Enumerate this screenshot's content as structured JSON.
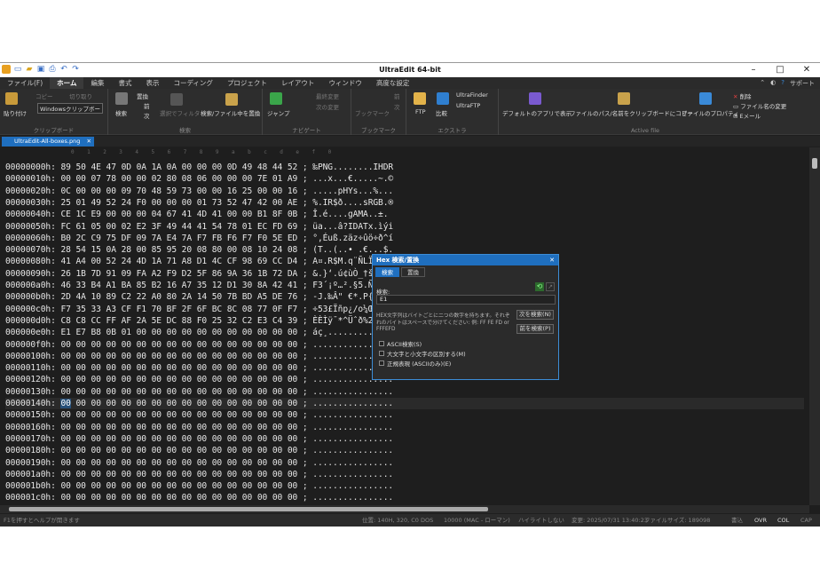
{
  "titlebar": {
    "title": "UltraEdit 64-bit"
  },
  "menu": [
    "ファイル(F)",
    "ホーム",
    "編集",
    "書式",
    "表示",
    "コーディング",
    "プロジェクト",
    "レイアウト",
    "ウィンドウ",
    "高度な設定"
  ],
  "menu_right": {
    "support": "サポート"
  },
  "ribbon": {
    "paste": "貼り付け",
    "copy": "コピー",
    "cut": "切り取り",
    "clipboard": "Windowsクリップボー",
    "clipboard_group": "クリップボード",
    "search": "検索",
    "replace": "置換",
    "prev": "前",
    "next": "次",
    "filter": "選択でフィルタ",
    "find_in_files": "検索/ファイル中を置換",
    "search_group": "検索",
    "jump": "ジャンプ",
    "last_change": "最終変更",
    "next_change": "次の変更",
    "navigate_group": "ナビゲート",
    "bookmark": "ブックマーク",
    "bm_prev": "前",
    "bm_next": "次",
    "bookmark_group": "ブックマーク",
    "ftp": "FTP",
    "compare": "比較",
    "ultrafinder": "UltraFinder",
    "ultraftp": "UltraFTP",
    "extra_group": "エクストラ",
    "default_app": "デフォルトのアプリで表示",
    "copy_path": "ファイルのパス/名前をクリップボードにコピー",
    "properties": "ファイルのプロパティ",
    "delete": "削除",
    "rename": "ファイル名の変更",
    "email": "Eメール",
    "active_file_group": "Active file"
  },
  "file_tab": "UltraEdit-All-boxes.png",
  "ruler": [
    "0",
    "1",
    "2",
    "3",
    "4",
    "5",
    "6",
    "7",
    "8",
    "9",
    "a",
    "b",
    "c",
    "d",
    "e",
    "f",
    "0"
  ],
  "rows": [
    {
      "addr": "00000000h:",
      "hex": "89 50 4E 47 0D 0A 1A 0A 00 00 00 0D 49 48 44 52",
      "txt": "‰PNG........IHDR"
    },
    {
      "addr": "00000010h:",
      "hex": "00 00 07 78 00 00 02 80 08 06 00 00 00 7E 01 A9",
      "txt": "...x...€.....~.©"
    },
    {
      "addr": "00000020h:",
      "hex": "0C 00 00 00 09 70 48 59 73 00 00 16 25 00 00 16",
      "txt": ".....pHYs...%..."
    },
    {
      "addr": "00000030h:",
      "hex": "25 01 49 52 24 F0 00 00 00 01 73 52 47 42 00 AE",
      "txt": "%.IR$ð....sRGB.®"
    },
    {
      "addr": "00000040h:",
      "hex": "CE 1C E9 00 00 00 04 67 41 4D 41 00 00 B1 8F 0B",
      "txt": "Î.é....gAMA..±."
    },
    {
      "addr": "00000050h:",
      "hex": "FC 61 05 00 02 E2 3F 49 44 41 54 78 01 EC FD 69",
      "txt": "üa...â?IDATx.ìýi"
    },
    {
      "addr": "00000060h:",
      "hex": "B0 2C C9 75 DF 09 7A E4 7A F7 FB F6 F7 F0 5E ED",
      "txt": "°,Éuß.zäz÷ûö÷ð^í"
    },
    {
      "addr": "00000070h:",
      "hex": "28 54 15 0A 28 00 85 95 20 08 80 00 08 10 24 08",
      "txt": "(T..(..• .€...$."
    },
    {
      "addr": "00000080h:",
      "hex": "41 A4 00 52 24 4D 1A 71 A8 D1 4C CF 98 69 CC D4",
      "txt": "A¤.R$M.q¨ÑLÏ˜iÌÔ"
    },
    {
      "addr": "00000090h:",
      "hex": "26 1B 7D 91 09 FA A2 F9 D2 5F 86 9A 36 1B 72 DA",
      "txt": "&.}‘.ú¢ùÒ_†š6.rÚ"
    },
    {
      "addr": "000000a0h:",
      "hex": "46 33 B4 A1 BA 85 B2 16 A7 35 12 D1 30 8A 42 41",
      "txt": "F3´¡º…².§5.Ñ0ŠBA"
    },
    {
      "addr": "000000b0h:",
      "hex": "2D 4A 10 89 C2 22 A0 80 2A 14 50 7B BD A5 DE 76",
      "txt": "-J.‰Â\" €*.P{½¥Þv"
    },
    {
      "addr": "000000c0h:",
      "hex": "F7 35 33 A3 CF F1 70 BF 2F 6F BC 8C 08 77 0F F7",
      "txt": "÷53£Ïñp¿/o¼Œ.w.÷"
    },
    {
      "addr": "000000d0h:",
      "hex": "C8 C8 CC FF AF 2A 5E DC 88 F0 25 32 C2 E3 C4 39",
      "txt": "ÈÈÌÿ¯*^Üˆð%2ÂãÄ9"
    },
    {
      "addr": "000000e0h:",
      "hex": "E1 E7 B8 0B 01 00 00 00 00 00 00 00 00 00 00 00",
      "txt": "áç¸............."
    },
    {
      "addr": "000000f0h:",
      "hex": "00 00 00 00 00 00 00 00 00 00 00 00 00 00 00 00",
      "txt": "................"
    },
    {
      "addr": "00000100h:",
      "hex": "00 00 00 00 00 00 00 00 00 00 00 00 00 00 00 00",
      "txt": "................"
    },
    {
      "addr": "00000110h:",
      "hex": "00 00 00 00 00 00 00 00 00 00 00 00 00 00 00 00",
      "txt": "................"
    },
    {
      "addr": "00000120h:",
      "hex": "00 00 00 00 00 00 00 00 00 00 00 00 00 00 00 00",
      "txt": "................"
    },
    {
      "addr": "00000130h:",
      "hex": "00 00 00 00 00 00 00 00 00 00 00 00 00 00 00 00",
      "txt": "................"
    },
    {
      "addr": "00000140h:",
      "hex": "00 00 00 00 00 00 00 00 00 00 00 00 00 00 00 00",
      "txt": "................",
      "cur": true
    },
    {
      "addr": "00000150h:",
      "hex": "00 00 00 00 00 00 00 00 00 00 00 00 00 00 00 00",
      "txt": "................"
    },
    {
      "addr": "00000160h:",
      "hex": "00 00 00 00 00 00 00 00 00 00 00 00 00 00 00 00",
      "txt": "................"
    },
    {
      "addr": "00000170h:",
      "hex": "00 00 00 00 00 00 00 00 00 00 00 00 00 00 00 00",
      "txt": "................"
    },
    {
      "addr": "00000180h:",
      "hex": "00 00 00 00 00 00 00 00 00 00 00 00 00 00 00 00",
      "txt": "................"
    },
    {
      "addr": "00000190h:",
      "hex": "00 00 00 00 00 00 00 00 00 00 00 00 00 00 00 00",
      "txt": "................"
    },
    {
      "addr": "000001a0h:",
      "hex": "00 00 00 00 00 00 00 00 00 00 00 00 00 00 00 00",
      "txt": "................"
    },
    {
      "addr": "000001b0h:",
      "hex": "00 00 00 00 00 00 00 00 00 00 00 00 00 00 00 00",
      "txt": "................"
    },
    {
      "addr": "000001c0h:",
      "hex": "00 00 00 00 00 00 00 00 00 00 00 00 00 00 00 00",
      "txt": "................"
    }
  ],
  "dialog": {
    "title": "Hex 検索/置換",
    "tab_search": "検索",
    "tab_replace": "置換",
    "label": "検索:",
    "value": "E1",
    "help": "HEX文字列はバイトごとに二つの数字を持ちます。それぞれのバイトはスペースで分けてください: 例: FF FE FD or FFFEFD",
    "find_next": "次を検索(N)",
    "find_prev": "前を検索(P)",
    "opt_ascii": "ASCII検索(S)",
    "opt_case": "大文字と小文字の区別する(M)",
    "opt_regex": "正規表現 (ASCIIのみ)(E)"
  },
  "status": {
    "help": "F1を押すとヘルプが開きます",
    "pos": "位置: 140H, 320, C0",
    "dos": "DOS",
    "enc": "10000 (MAC - ローマン)",
    "hl": "ハイライトしない",
    "mod": "変更: 2025/07/31 13:40:23",
    "size": "ファイルサイズ: 189098",
    "rw": "書込",
    "ovr": "OVR",
    "col": "COL",
    "cap": "CAP"
  }
}
